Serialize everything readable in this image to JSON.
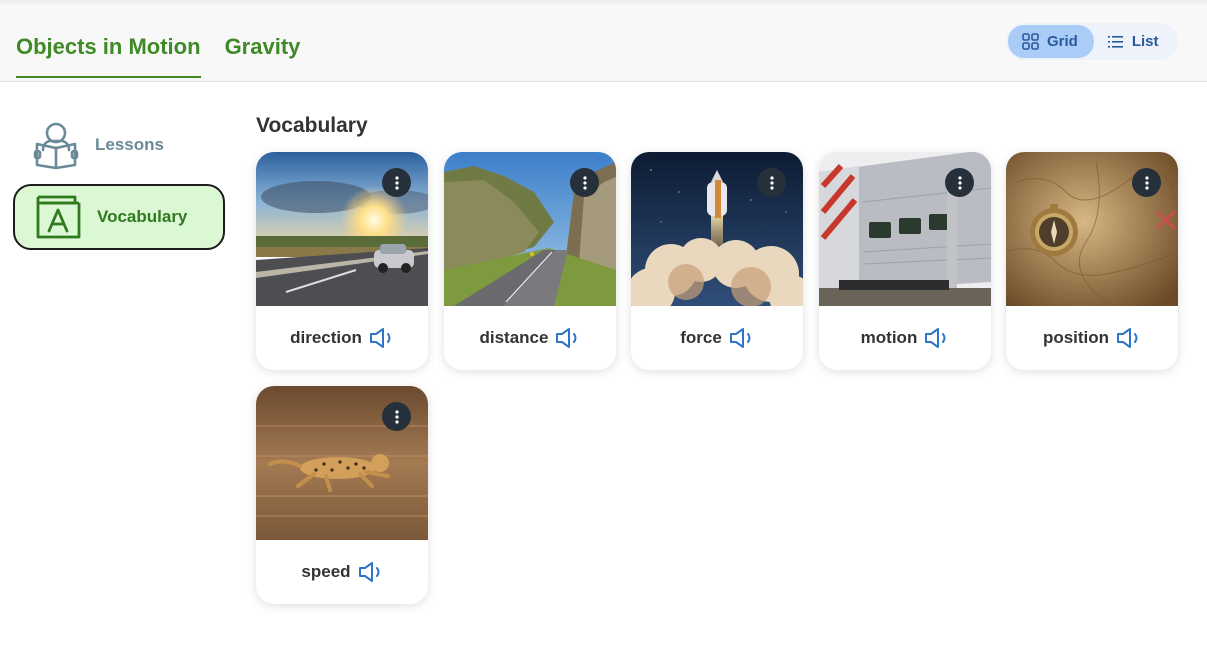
{
  "header": {
    "tabs": [
      {
        "label": "Objects in Motion",
        "active": true
      },
      {
        "label": "Gravity",
        "active": false
      }
    ],
    "view_toggle": {
      "grid_label": "Grid",
      "list_label": "List",
      "selected": "Grid"
    }
  },
  "sidebar": {
    "items": [
      {
        "label": "Lessons",
        "icon": "reading-person-icon",
        "selected": false
      },
      {
        "label": "Vocabulary",
        "icon": "vocabulary-book-icon",
        "selected": true
      }
    ]
  },
  "main": {
    "title": "Vocabulary",
    "cards": [
      {
        "word": "direction",
        "image": "car-on-highway-at-sunset"
      },
      {
        "word": "distance",
        "image": "highway-through-mountain-pass"
      },
      {
        "word": "force",
        "image": "rocket-launch"
      },
      {
        "word": "motion",
        "image": "commuter-train"
      },
      {
        "word": "position",
        "image": "compass-on-map"
      },
      {
        "word": "speed",
        "image": "running-cheetah"
      }
    ]
  },
  "colors": {
    "tab_green": "#3f8a26",
    "selected_side_bg": "#dcf7d3",
    "toggle_active": "#a9cdf6",
    "speaker_blue": "#2f74c9"
  }
}
